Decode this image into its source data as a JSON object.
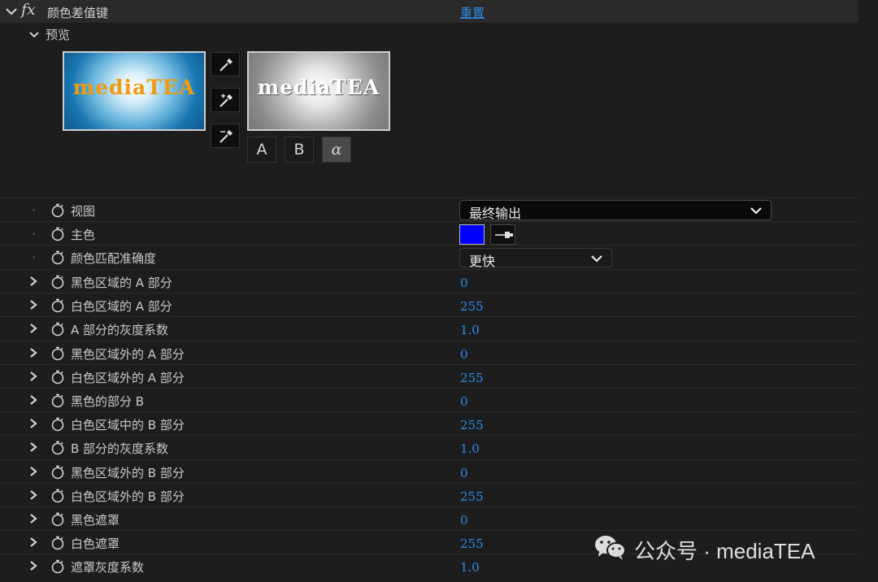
{
  "effect": {
    "name": "颜色差值键",
    "fx": "fx",
    "reset": "重置"
  },
  "preview": {
    "label": "预览",
    "left_logo": "mediaTEA",
    "right_logo": "mediaTEA",
    "channels": [
      "A",
      "B",
      "α"
    ],
    "active_channel": "α"
  },
  "view": {
    "label": "视图",
    "value": "最终输出"
  },
  "key_color": {
    "label": "主色",
    "color": "#0000ff"
  },
  "match": {
    "label": "颜色匹配准确度",
    "value": "更快"
  },
  "params": [
    {
      "label": "黑色区域的 A 部分",
      "value": "0"
    },
    {
      "label": "白色区域的 A 部分",
      "value": "255"
    },
    {
      "label": "A 部分的灰度系数",
      "value": "1.0"
    },
    {
      "label": "黑色区域外的 A 部分",
      "value": "0"
    },
    {
      "label": "白色区域外的 A 部分",
      "value": "255"
    },
    {
      "label": "黑色的部分 B",
      "value": "0"
    },
    {
      "label": "白色区域中的 B 部分",
      "value": "255"
    },
    {
      "label": "B 部分的灰度系数",
      "value": "1.0"
    },
    {
      "label": "黑色区域外的 B 部分",
      "value": "0"
    },
    {
      "label": "白色区域外的 B 部分",
      "value": "255"
    },
    {
      "label": "黑色遮罩",
      "value": "0"
    },
    {
      "label": "白色遮罩",
      "value": "255"
    },
    {
      "label": "遮罩灰度系数",
      "value": "1.0"
    }
  ],
  "watermark": {
    "text": "公众号 · mediaTEA",
    "icon": "wechat-icon"
  },
  "colors": {
    "link_blue": "#2d8ceb",
    "panel_bg": "#1d1d1d",
    "header_bg": "#2a2a2a",
    "key": "#0000ff"
  }
}
